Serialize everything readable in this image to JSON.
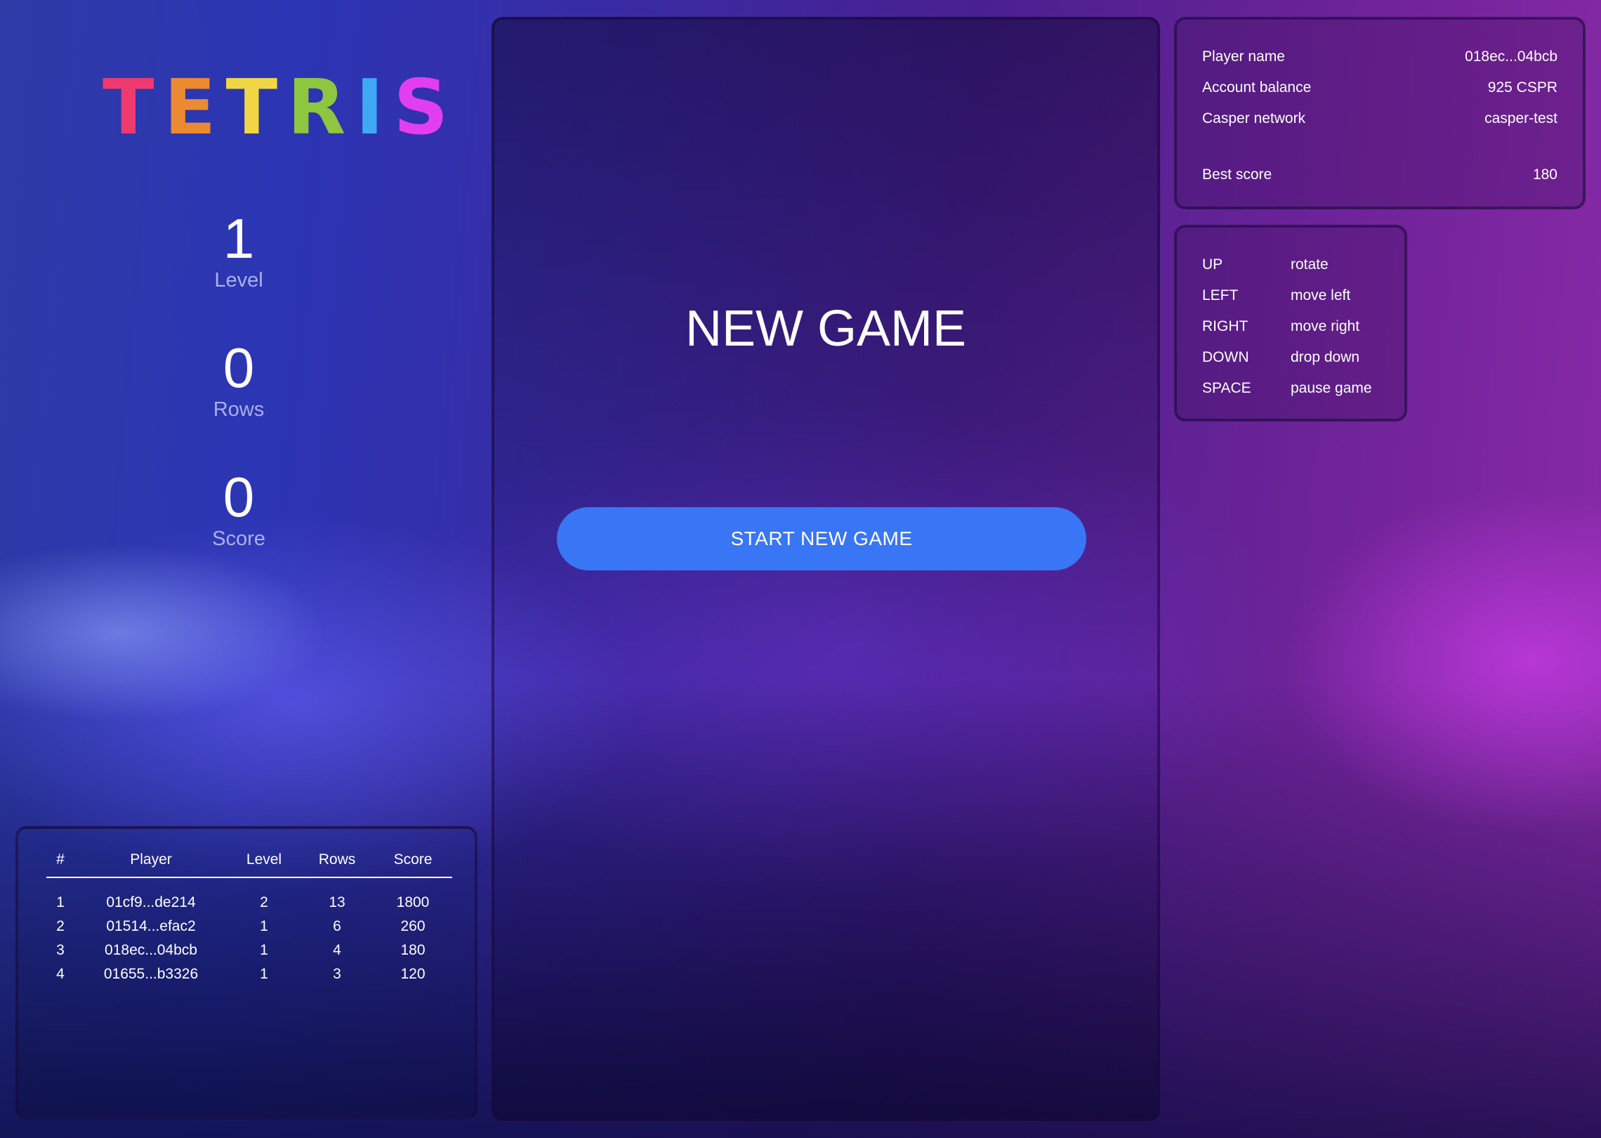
{
  "logo": {
    "letters": [
      "T",
      "E",
      "T",
      "R",
      "I",
      "S"
    ],
    "colors": [
      "#ee3a6e",
      "#ec8a32",
      "#f0d645",
      "#8ec63f",
      "#3fa9f5",
      "#e23ef0"
    ]
  },
  "stats": {
    "level": {
      "value": "1",
      "label": "Level"
    },
    "rows": {
      "value": "0",
      "label": "Rows"
    },
    "score": {
      "value": "0",
      "label": "Score"
    }
  },
  "leaderboard": {
    "headers": [
      "#",
      "Player",
      "Level",
      "Rows",
      "Score"
    ],
    "rows": [
      [
        "1",
        "01cf9...de214",
        "2",
        "13",
        "1800"
      ],
      [
        "2",
        "01514...efac2",
        "1",
        "6",
        "260"
      ],
      [
        "3",
        "018ec...04bcb",
        "1",
        "4",
        "180"
      ],
      [
        "4",
        "01655...b3326",
        "1",
        "3",
        "120"
      ]
    ]
  },
  "game": {
    "title": "NEW GAME",
    "start_button": "START NEW GAME",
    "button_color": "#3876f5"
  },
  "player_info": {
    "player_name": {
      "label": "Player name",
      "value": "018ec...04bcb"
    },
    "balance": {
      "label": "Account balance",
      "value": "925 CSPR"
    },
    "network": {
      "label": "Casper network",
      "value": "casper-test"
    },
    "best_score": {
      "label": "Best score",
      "value": "180"
    }
  },
  "controls": [
    {
      "key": "UP",
      "action": "rotate"
    },
    {
      "key": "LEFT",
      "action": "move left"
    },
    {
      "key": "RIGHT",
      "action": "move right"
    },
    {
      "key": "DOWN",
      "action": "drop down"
    },
    {
      "key": "SPACE",
      "action": "pause game"
    }
  ]
}
